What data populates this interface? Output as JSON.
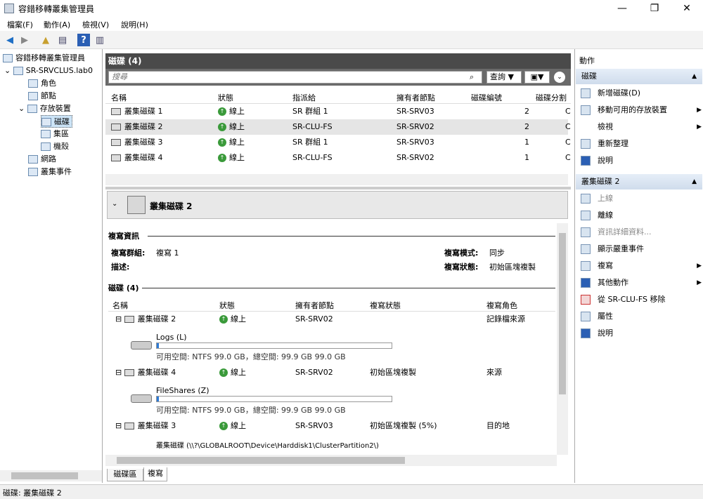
{
  "window": {
    "title": "容錯移轉叢集管理員",
    "min": "—",
    "max": "❐",
    "close": "✕"
  },
  "menu": [
    "檔案(F)",
    "動作(A)",
    "檢視(V)",
    "說明(H)"
  ],
  "tree": {
    "root": "容錯移轉叢集管理員",
    "cluster": "SR-SRVCLUS.lab0",
    "items": [
      "角色",
      "節點",
      "存放裝置",
      "磁碟",
      "集區",
      "機殼",
      "網路",
      "叢集事件"
    ]
  },
  "disks_panel": {
    "title": "磁碟 (4)",
    "search_placeholder": "搜尋",
    "query_label": "查詢",
    "columns": [
      "名稱",
      "狀態",
      "指派給",
      "擁有者節點",
      "磁碟編號",
      "磁碟分割"
    ],
    "rows": [
      {
        "name": "叢集磁碟 1",
        "status": "線上",
        "assigned": "SR 群組 1",
        "owner": "SR-SRV03",
        "num": "2",
        "part": "C"
      },
      {
        "name": "叢集磁碟 2",
        "status": "線上",
        "assigned": "SR-CLU-FS",
        "owner": "SR-SRV02",
        "num": "2",
        "part": "C"
      },
      {
        "name": "叢集磁碟 3",
        "status": "線上",
        "assigned": "SR 群組 1",
        "owner": "SR-SRV03",
        "num": "1",
        "part": "C"
      },
      {
        "name": "叢集磁碟 4",
        "status": "線上",
        "assigned": "SR-CLU-FS",
        "owner": "SR-SRV02",
        "num": "1",
        "part": "C"
      }
    ]
  },
  "detail": {
    "title": "叢集磁碟 2",
    "section1": "複寫資訊",
    "rep_group_label": "複寫群組:",
    "rep_group_value": "複寫 1",
    "desc_label": "描述:",
    "rep_mode_label": "複寫模式:",
    "rep_mode_value": "同步",
    "rep_state_label": "複寫狀態:",
    "rep_state_value": "初始區塊複製",
    "section2": "磁碟 (4)",
    "columns": [
      "名稱",
      "狀態",
      "擁有者節點",
      "複寫狀態",
      "複寫角色"
    ],
    "rows": [
      {
        "name": "叢集磁碟 2",
        "status": "線上",
        "owner": "SR-SRV02",
        "state": "",
        "role": "記錄檔來源",
        "vol": "Logs (L)",
        "space": "可用空間: NTFS 99.0 GB，總空間: 99.9 GB 99.0 GB",
        "used": 0.01
      },
      {
        "name": "叢集磁碟 4",
        "status": "線上",
        "owner": "SR-SRV02",
        "state": "初始區塊複製",
        "role": "來源",
        "vol": "FileShares (Z)",
        "space": "可用空間: NTFS 99.0 GB，總空間: 99.9 GB 99.0 GB",
        "used": 0.01
      },
      {
        "name": "叢集磁碟 3",
        "status": "線上",
        "owner": "SR-SRV03",
        "state": "初始區塊複製 (5%)",
        "role": "目的地",
        "vol": "叢集磁碟 (\\\\?\\GLOBALROOT\\Device\\Harddisk1\\ClusterPartition2\\)",
        "space": "",
        "used": 0
      }
    ],
    "tabs": [
      "磁碟區",
      "複寫"
    ]
  },
  "actions": {
    "title": "動作",
    "group1": "磁碟",
    "g1items": [
      "新增磁碟(D)",
      "移動可用的存放裝置",
      "檢視",
      "重新整理",
      "說明"
    ],
    "group2": "叢集磁碟 2",
    "g2items": [
      "上線",
      "離線",
      "資訊詳細資料...",
      "顯示嚴重事件",
      "複寫",
      "其他動作",
      "從 SR-CLU-FS 移除",
      "屬性",
      "說明"
    ]
  },
  "status": "磁碟: 叢集磁碟 2"
}
